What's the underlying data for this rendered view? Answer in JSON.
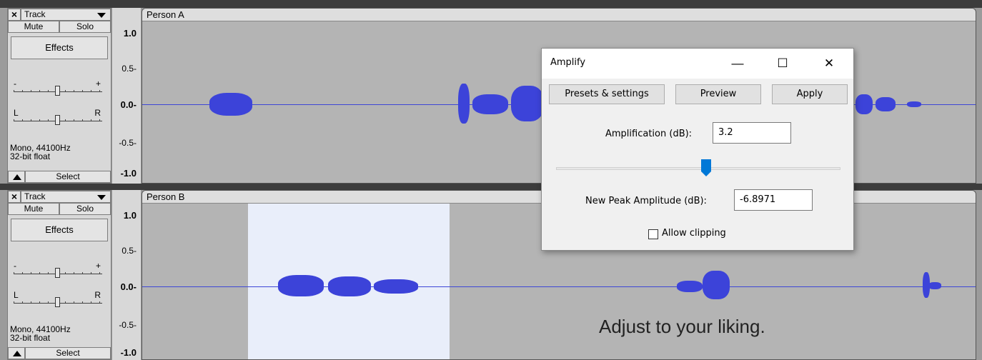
{
  "tracks": [
    {
      "name": "Track",
      "clip_title": "Person A",
      "mute_label": "Mute",
      "solo_label": "Solo",
      "effects_label": "Effects",
      "gain_minus": "-",
      "gain_plus": "+",
      "pan_left": "L",
      "pan_right": "R",
      "format_line1": "Mono, 44100Hz",
      "format_line2": "32-bit float",
      "select_label": "Select",
      "ruler": [
        "1.0",
        "0.5-",
        "0.0-",
        "-0.5-",
        "-1.0"
      ]
    },
    {
      "name": "Track",
      "clip_title": "Person B",
      "mute_label": "Mute",
      "solo_label": "Solo",
      "effects_label": "Effects",
      "gain_minus": "-",
      "gain_plus": "+",
      "pan_left": "L",
      "pan_right": "R",
      "format_line1": "Mono, 44100Hz",
      "format_line2": "32-bit float",
      "select_label": "Select",
      "ruler": [
        "1.0",
        "0.5-",
        "0.0-",
        "-0.5-",
        "-1.0"
      ]
    }
  ],
  "close_glyph": "×",
  "ruler_arrow": "←",
  "caption": "Adjust to your liking.",
  "dialog": {
    "title": "Amplify",
    "minimize_glyph": "—",
    "maximize_glyph": "☐",
    "close_glyph": "✕",
    "presets_label": "Presets & settings",
    "preview_label": "Preview",
    "apply_label": "Apply",
    "amplification_label": "Amplification (dB):",
    "amplification_value": "3.2",
    "peak_label": "New Peak Amplitude (dB):",
    "peak_value": "-6.8971",
    "allow_clipping_label": "Allow clipping",
    "allow_clipping_checked": false
  },
  "colors": {
    "waveform": "#3c43d9",
    "selection": "#e9eefa",
    "slider_thumb": "#0078d7"
  }
}
